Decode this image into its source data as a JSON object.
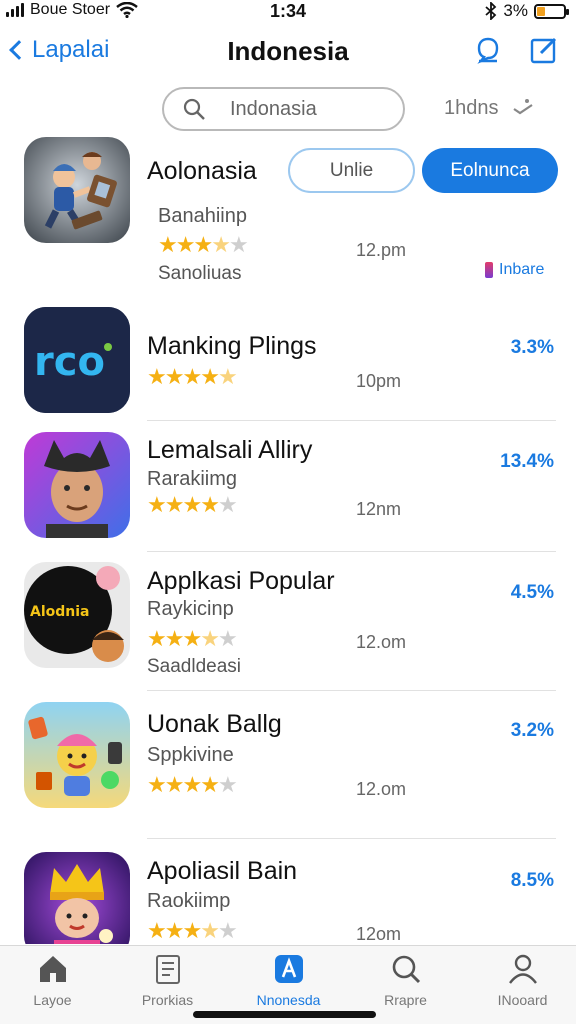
{
  "status_bar": {
    "carrier": "Boue Stoer",
    "time": "1:34",
    "battery_text": "3%",
    "battery_level": 0.3
  },
  "nav": {
    "back_label": "Lapalai",
    "title": "Indonesia"
  },
  "search": {
    "placeholder": "Indonasia",
    "filter_label": "1hdns"
  },
  "featured": {
    "name": "Aolonasia",
    "subtitle": "Banahiinp",
    "extra": "Sanoliuas",
    "time": "12.pm",
    "rating": 3.5,
    "buttons": {
      "outline": "Unlie",
      "filled": "Eolnunca"
    },
    "tag": "Inbare"
  },
  "apps": [
    {
      "name": "Manking Plings",
      "subtitle": "",
      "extra": "",
      "time": "10pm",
      "percent": "3.3%",
      "rating": 4.5
    },
    {
      "name": "Lemalsali Alliry",
      "subtitle": "Rarakiimg",
      "extra": "",
      "time": "12nm",
      "percent": "13.4%",
      "rating": 4
    },
    {
      "name": "Applkasi Popular",
      "subtitle": "Raykicinp",
      "extra": "Saadldeasi",
      "time": "12.om",
      "percent": "4.5%",
      "rating": 3.5
    },
    {
      "name": "Uonak Ballg",
      "subtitle": "Sppkivine",
      "extra": "",
      "time": "12.om",
      "percent": "3.2%",
      "rating": 4
    },
    {
      "name": "Apoliasil Bain",
      "subtitle": "Raokiimp",
      "extra": "",
      "time": "12om",
      "percent": "8.5%",
      "rating": 3.5
    }
  ],
  "app_icon_texts": {
    "app1": "rco",
    "app3": "Alodnia"
  },
  "tabs": [
    {
      "label": "Layoe",
      "icon": "home-icon",
      "active": false
    },
    {
      "label": "Prorkias",
      "icon": "document-icon",
      "active": false
    },
    {
      "label": "Nnonesda",
      "icon": "store-icon",
      "active": true
    },
    {
      "label": "Rrapre",
      "icon": "search-icon",
      "active": false
    },
    {
      "label": "INooard",
      "icon": "profile-icon",
      "active": false
    }
  ],
  "colors": {
    "accent": "#1a7ae0",
    "star": "#f5b013",
    "star_off": "#cfcfcf"
  }
}
